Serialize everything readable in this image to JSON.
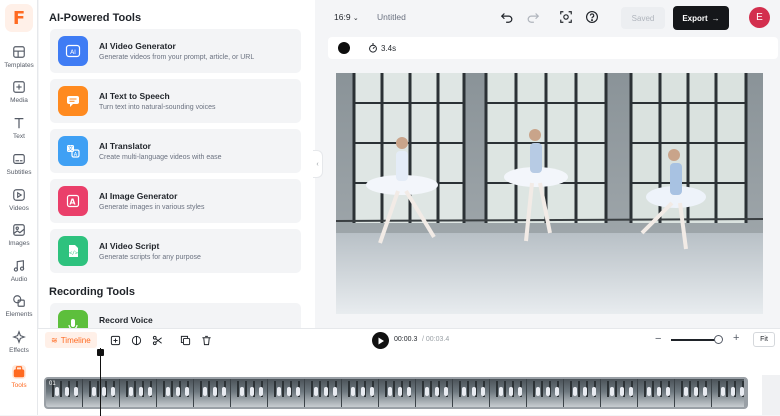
{
  "app": {
    "logo_letter": "F",
    "brand_color": "#ff6a21"
  },
  "sidebar": {
    "items": [
      {
        "label": "Templates",
        "icon": "templates-icon"
      },
      {
        "label": "Media",
        "icon": "media-icon"
      },
      {
        "label": "Text",
        "icon": "text-icon"
      },
      {
        "label": "Subtitles",
        "icon": "subtitles-icon"
      },
      {
        "label": "Videos",
        "icon": "videos-icon"
      },
      {
        "label": "Images",
        "icon": "images-icon"
      },
      {
        "label": "Audio",
        "icon": "audio-icon"
      },
      {
        "label": "Elements",
        "icon": "elements-icon"
      },
      {
        "label": "Effects",
        "icon": "effects-icon"
      },
      {
        "label": "Tools",
        "icon": "tools-icon",
        "active": true
      }
    ]
  },
  "panel": {
    "title": "AI-Powered Tools",
    "tools": [
      {
        "title": "AI Video Generator",
        "desc": "Generate videos from your prompt, article, or URL",
        "icon": "ai-video-icon",
        "color": "#3f7cf4"
      },
      {
        "title": "AI Text to Speech",
        "desc": "Turn text into natural-sounding voices",
        "icon": "chat-bubble-icon",
        "color": "#ff8a1f"
      },
      {
        "title": "AI Translator",
        "desc": "Create multi-language videos with ease",
        "icon": "translate-icon",
        "color": "#3fa0f4"
      },
      {
        "title": "AI Image Generator",
        "desc": "Generate images in various styles",
        "icon": "image-generator-icon",
        "color": "#ea3f6a"
      },
      {
        "title": "AI Video Script",
        "desc": "Generate scripts for any purpose",
        "icon": "code-doc-icon",
        "color": "#2ec27e"
      }
    ],
    "section2_title": "Recording Tools",
    "recording": [
      {
        "title": "Record Voice",
        "icon": "microphone-icon",
        "color": "#5dbf3c"
      }
    ]
  },
  "topbar": {
    "aspect_ratio": "16:9",
    "project_title": "Untitled",
    "saved_label": "Saved",
    "export_label": "Export",
    "avatar_initial": "E"
  },
  "canvas": {
    "duration": "3.4s"
  },
  "timeline": {
    "tab_label": "Timeline",
    "current_time": "00:00.3",
    "separator": "/",
    "total_time": "00:03.4",
    "fit_label": "Fit",
    "clip_label": "01",
    "zoom_level": 0.9,
    "playhead_time": "00:00.3"
  }
}
